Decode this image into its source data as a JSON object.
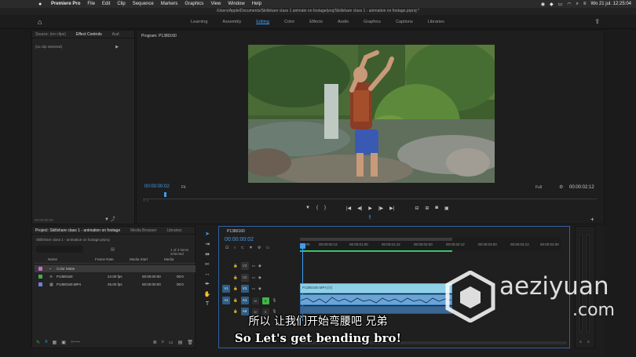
{
  "menubar": {
    "app": "Premiere Pro",
    "items": [
      "File",
      "Edit",
      "Clip",
      "Sequence",
      "Markers",
      "Graphics",
      "View",
      "Window",
      "Help"
    ],
    "clock": "Wo 21 jul.  12:25:04"
  },
  "window_title": "/Users/Apple/Documents/Skillshare class 1 animate on footage/proj/Skillshare class 1 - animation on footage.prproj *",
  "workspaces": [
    "Learning",
    "Assembly",
    "Editing",
    "Color",
    "Effects",
    "Audio",
    "Graphics",
    "Captions",
    "Libraries"
  ],
  "workspace_active": "Editing",
  "source_panel": {
    "tabs": [
      "Source: (no clips)",
      "Effect Controls",
      "Aud"
    ],
    "active_tab": "Effect Controls",
    "no_clip": "(no clip selected)",
    "timecode": "00:00:00:00"
  },
  "program": {
    "title": "Program: P1380160",
    "timecode": "00:00:00:02",
    "fit": "Fit",
    "resolution": "Full",
    "duration": "00:00:02:12"
  },
  "project": {
    "tabs": [
      "Project: Skillshare class 1 - animation on footage",
      "Media Browser",
      "Libraries"
    ],
    "path": "Skillshare class 1 - animation on footage.prproj",
    "selection": "1 of 3 items selected",
    "columns": [
      "Name",
      "Frame Rate",
      "Media Start",
      "Media"
    ],
    "items": [
      {
        "name": "Color Matte",
        "rate": "",
        "start": "",
        "media": "",
        "color": "#c86cc4",
        "icon": "matte-icon"
      },
      {
        "name": "P1380160",
        "rate": "24.00 fps",
        "start": "00:00:00:00",
        "media": "00:0",
        "color": "#3fae4e",
        "icon": "sequence-icon"
      },
      {
        "name": "P1380160.MP4",
        "rate": "25.00 fps",
        "start": "00:00:00:00",
        "media": "00:0",
        "color": "#6d7fe0",
        "icon": "clip-icon"
      }
    ]
  },
  "timeline": {
    "title": "P1380160",
    "timecode": "00:00:00:02",
    "ruler": [
      ":00:00",
      "00:00:00:12",
      "00:00:01:00",
      "00:00:01:12",
      "00:00:02:00",
      "00:00:02:12",
      "00:00:03:00",
      "00:00:03:12",
      "00:00:04:00"
    ],
    "tracks": [
      "V3",
      "V2",
      "V1",
      "A1",
      "A2",
      "A3"
    ],
    "clip_label": "P1380160.MP4 [V]"
  },
  "meters": {
    "labels": [
      "S",
      "S"
    ]
  },
  "subtitles": {
    "chinese": "所以 让我们开始弯腰吧 兄弟",
    "english": "So Let's get bending bro!"
  },
  "watermark": {
    "brand": "aeziyuan",
    "domain": ".com"
  }
}
